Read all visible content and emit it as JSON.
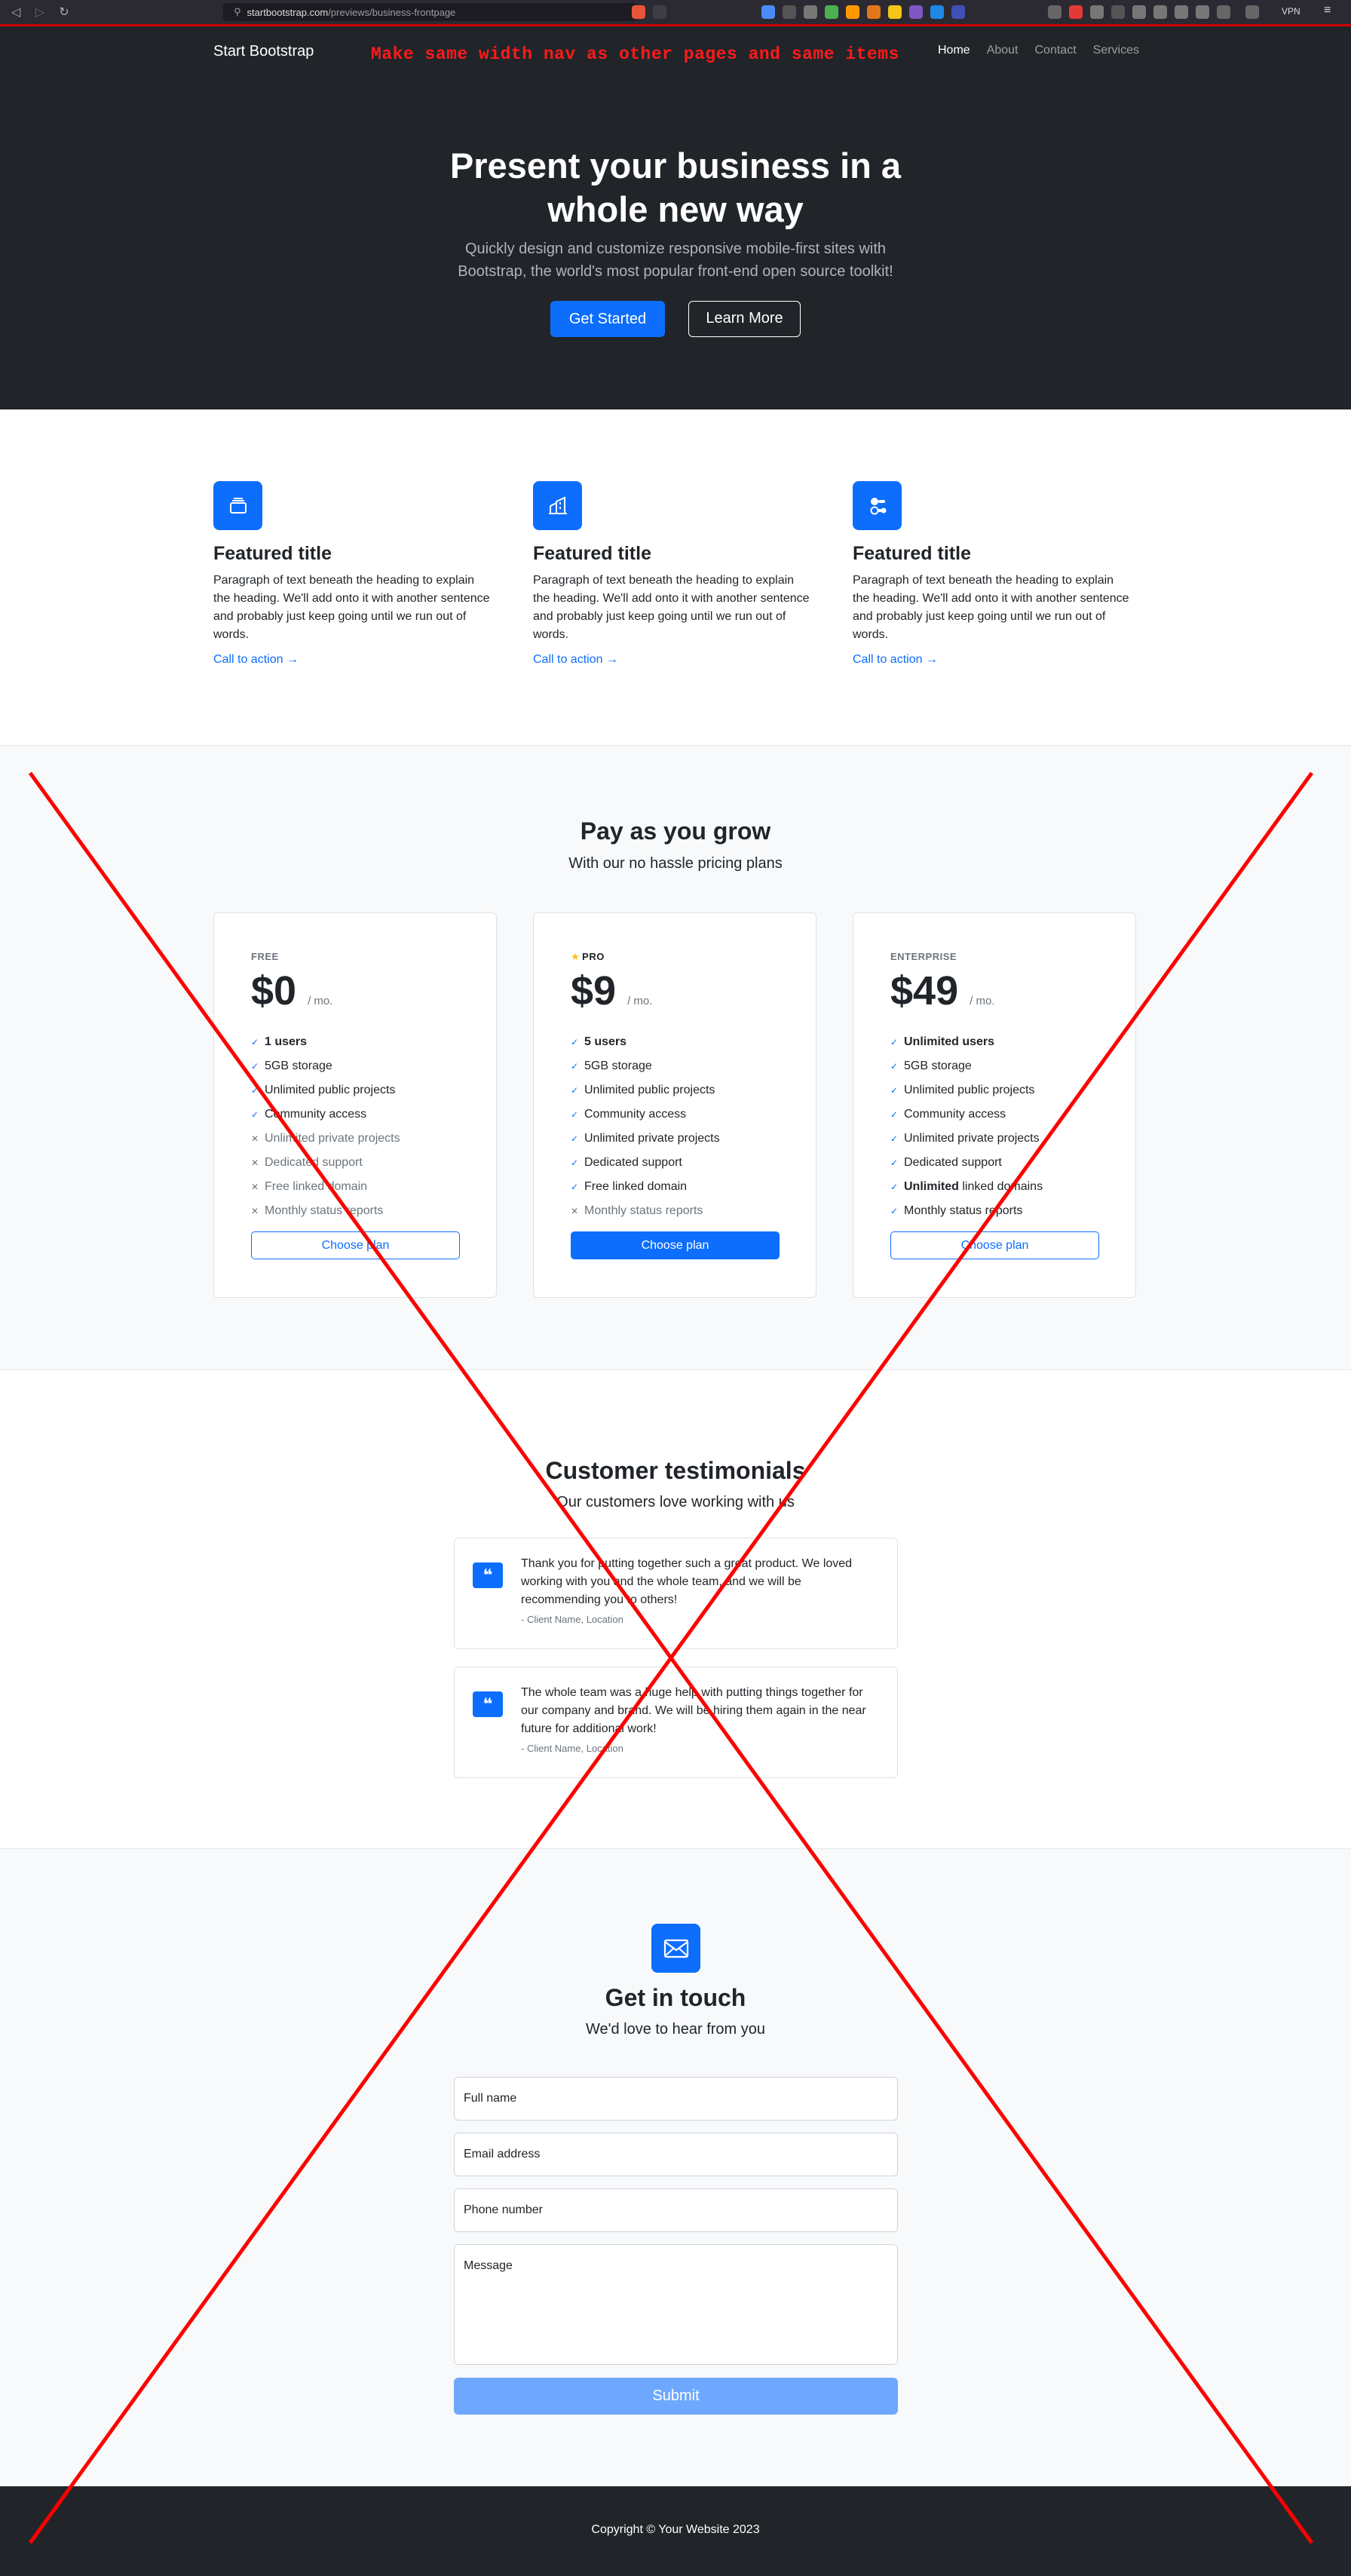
{
  "browser": {
    "url_host": "startbootstrap.com",
    "url_path": "/previews/business-frontpage",
    "vpn_label": "VPN"
  },
  "nav": {
    "brand": "Start Bootstrap",
    "annotation": "Make same width nav as other pages and same items",
    "links": [
      "Home",
      "About",
      "Contact",
      "Services"
    ]
  },
  "hero": {
    "title": "Present your business in a whole new way",
    "subtitle": "Quickly design and customize responsive mobile-first sites with Bootstrap, the world's most popular front-end open source toolkit!",
    "primary_button": "Get Started",
    "secondary_button": "Learn More"
  },
  "features": [
    {
      "icon": "collection-icon",
      "title": "Featured title",
      "text": "Paragraph of text beneath the heading to explain the heading. We'll add onto it with another sentence and probably just keep going until we run out of words.",
      "cta": "Call to action →"
    },
    {
      "icon": "building-icon",
      "title": "Featured title",
      "text": "Paragraph of text beneath the heading to explain the heading. We'll add onto it with another sentence and probably just keep going until we run out of words.",
      "cta": "Call to action →"
    },
    {
      "icon": "toggles-icon",
      "title": "Featured title",
      "text": "Paragraph of text beneath the heading to explain the heading. We'll add onto it with another sentence and probably just keep going until we run out of words.",
      "cta": "Call to action →"
    }
  ],
  "pricing": {
    "title": "Pay as you grow",
    "subtitle": "With our no hassle pricing plans",
    "plans": [
      {
        "name": "FREE",
        "price": "$0",
        "per": "/ mo.",
        "button": "Choose plan",
        "items": [
          {
            "pre": "",
            "bold": "1 users",
            "post": "",
            "on": true
          },
          {
            "pre": "5GB storage",
            "bold": "",
            "post": "",
            "on": true
          },
          {
            "pre": "Unlimited public projects",
            "bold": "",
            "post": "",
            "on": true
          },
          {
            "pre": "Community access",
            "bold": "",
            "post": "",
            "on": true
          },
          {
            "pre": "Unlimited private projects",
            "bold": "",
            "post": "",
            "on": false
          },
          {
            "pre": "Dedicated support",
            "bold": "",
            "post": "",
            "on": false
          },
          {
            "pre": "Free linked domain",
            "bold": "",
            "post": "",
            "on": false
          },
          {
            "pre": "Monthly status reports",
            "bold": "",
            "post": "",
            "on": false
          }
        ]
      },
      {
        "name": "PRO",
        "price": "$9",
        "per": "/ mo.",
        "button": "Choose plan",
        "items": [
          {
            "pre": "",
            "bold": "5 users",
            "post": "",
            "on": true
          },
          {
            "pre": "5GB storage",
            "bold": "",
            "post": "",
            "on": true
          },
          {
            "pre": "Unlimited public projects",
            "bold": "",
            "post": "",
            "on": true
          },
          {
            "pre": "Community access",
            "bold": "",
            "post": "",
            "on": true
          },
          {
            "pre": "Unlimited private projects",
            "bold": "",
            "post": "",
            "on": true
          },
          {
            "pre": "Dedicated support",
            "bold": "",
            "post": "",
            "on": true
          },
          {
            "pre": "Free linked domain",
            "bold": "",
            "post": "",
            "on": true
          },
          {
            "pre": "Monthly status reports",
            "bold": "",
            "post": "",
            "on": false
          }
        ]
      },
      {
        "name": "ENTERPRISE",
        "price": "$49",
        "per": "/ mo.",
        "button": "Choose plan",
        "items": [
          {
            "pre": "",
            "bold": "Unlimited users",
            "post": "",
            "on": true
          },
          {
            "pre": "5GB storage",
            "bold": "",
            "post": "",
            "on": true
          },
          {
            "pre": "Unlimited public projects",
            "bold": "",
            "post": "",
            "on": true
          },
          {
            "pre": "Community access",
            "bold": "",
            "post": "",
            "on": true
          },
          {
            "pre": "Unlimited private projects",
            "bold": "",
            "post": "",
            "on": true
          },
          {
            "pre": "Dedicated support",
            "bold": "",
            "post": "",
            "on": true
          },
          {
            "pre": "",
            "bold": "Unlimited",
            "post": " linked domains",
            "on": true
          },
          {
            "pre": "Monthly status reports",
            "bold": "",
            "post": "",
            "on": true
          }
        ]
      }
    ]
  },
  "testimonials": {
    "title": "Customer testimonials",
    "subtitle": "Our customers love working with us",
    "items": [
      {
        "quote": "Thank you for putting together such a great product. We loved working with you and the whole team, and we will be recommending you to others!",
        "by": "- Client Name, Location"
      },
      {
        "quote": "The whole team was a huge help with putting things together for our company and brand. We will be hiring them again in the near future for additional work!",
        "by": "- Client Name, Location"
      }
    ]
  },
  "contact": {
    "title": "Get in touch",
    "subtitle": "We'd love to hear from you",
    "fields": {
      "name": "Full name",
      "email": "Email address",
      "phone": "Phone number",
      "message": "Message"
    },
    "submit": "Submit"
  },
  "footer": {
    "copyright": "Copyright © Your Website 2023"
  },
  "colors": {
    "accent": "#0d6efd",
    "dark": "#212529",
    "annotation_red": "#ff1a1a"
  }
}
